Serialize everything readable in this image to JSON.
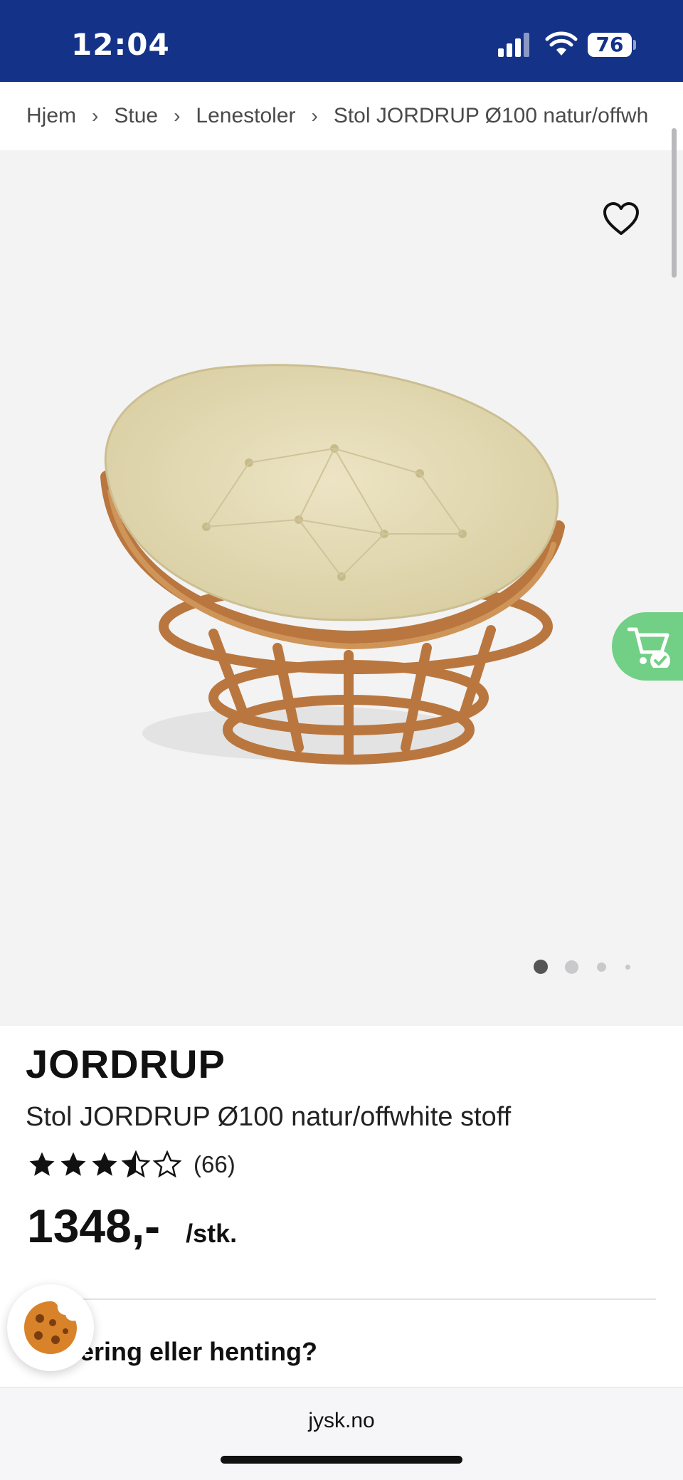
{
  "status_bar": {
    "time": "12:04",
    "battery": "76",
    "background": "#143388"
  },
  "breadcrumb": [
    "Hjem",
    "Stue",
    "Lenestoler",
    "Stol JORDRUP Ø100 natur/offwh"
  ],
  "breadcrumb_separator": "›",
  "gallery": {
    "favorite_icon": "heart-outline-icon",
    "cart_icon": "cart-check-icon",
    "cart_color": "#72cf86",
    "image_count": 4,
    "active_image_index": 0
  },
  "product": {
    "brand": "JORDRUP",
    "name": "Stol JORDRUP Ø100 natur/offwhite stoff",
    "rating": 3.5,
    "rating_max": 5,
    "review_count": "(66)",
    "price": "1348,-",
    "unit": "/stk."
  },
  "delivery": {
    "question": "Levering eller henting?",
    "visible_text": "ering eller henting?"
  },
  "cookie": {
    "icon": "cookie-icon"
  },
  "browser": {
    "url": "jysk.no"
  }
}
